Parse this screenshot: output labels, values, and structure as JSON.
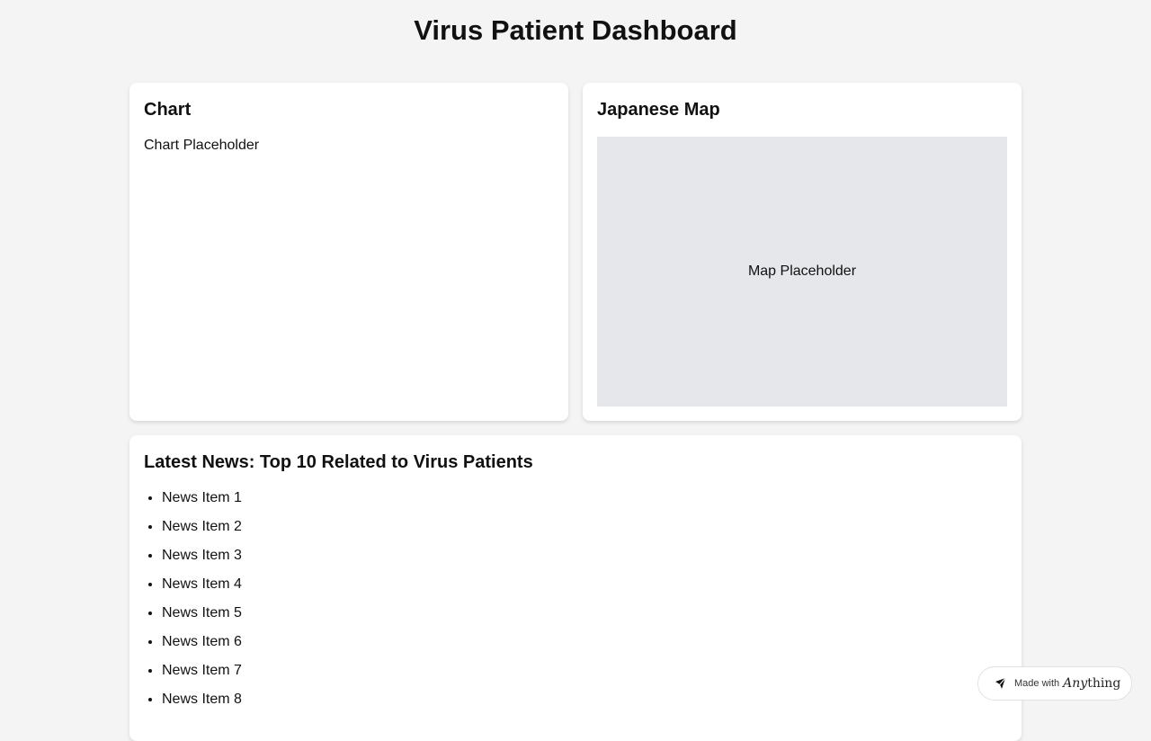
{
  "page": {
    "title": "Virus Patient Dashboard"
  },
  "chart_card": {
    "title": "Chart",
    "placeholder": "Chart Placeholder"
  },
  "map_card": {
    "title": "Japanese Map",
    "placeholder": "Map Placeholder",
    "placeholder_bg": "#e5e7eb"
  },
  "news_card": {
    "title": "Latest News: Top 10 Related to Virus Patients",
    "items": [
      "News Item 1",
      "News Item 2",
      "News Item 3",
      "News Item 4",
      "News Item 5",
      "News Item 6",
      "News Item 7",
      "News Item 8"
    ]
  },
  "badge": {
    "prefix": "Made with",
    "brand_any": "Any",
    "brand_thing": "thing",
    "icon": "anything-logo-icon"
  }
}
